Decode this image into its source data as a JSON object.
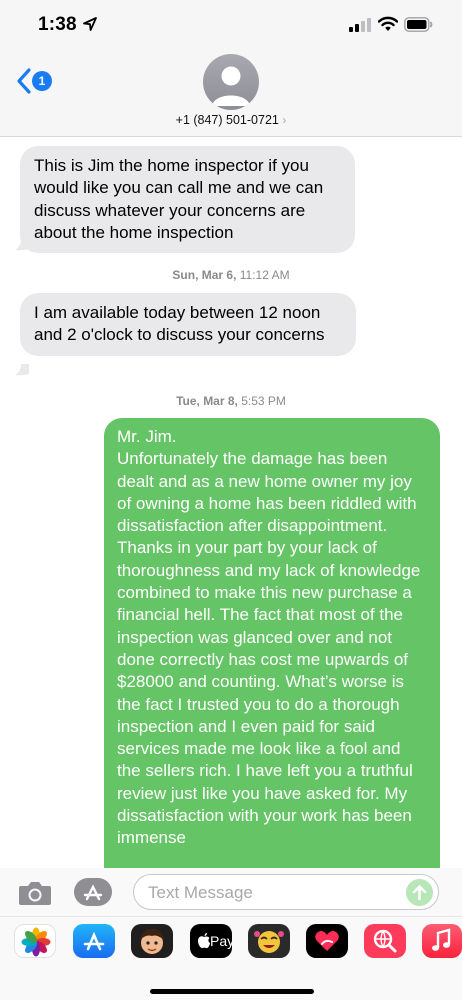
{
  "status_bar": {
    "time": "1:38"
  },
  "header": {
    "back_badge": "1",
    "contact": "+1 (847) 501-0721",
    "contact_chevron": "›"
  },
  "messages": [
    {
      "text": "This is Jim the home inspector if you would like you can call me and we can discuss  whatever your concerns are about the home inspection"
    },
    {
      "text": "I am available today between 12 noon and 2 o'clock to discuss your concerns"
    },
    {
      "text": "Mr. Jim.\nUnfortunately the damage has been dealt and as a new home owner my joy of owning a home has been riddled with dissatisfaction after disappointment. Thanks in your part by your lack of thoroughness and my lack of knowledge combined to make this new purchase a financial hell. The fact that most of the inspection was glanced over and not done correctly has cost me upwards of $28000 and counting. What’s worse is the fact I trusted you to do a thorough inspection and I even paid for said services made me look like a fool and the sellers rich. I have left you a truthful review just like you have asked for. My dissatisfaction with your work has been immense"
    }
  ],
  "timestamps": [
    {
      "day": "Sun, Mar 6,",
      "time": "11:12 AM"
    },
    {
      "day": "Tue, Mar 8,",
      "time": "5:53 PM"
    }
  ],
  "input": {
    "placeholder": "Text Message"
  },
  "drawer": {
    "applepay_label": "Pay"
  },
  "colors": {
    "sent_bubble": "#65c466",
    "received_bubble": "#e9e9eb",
    "accent": "#1a7cf5"
  }
}
